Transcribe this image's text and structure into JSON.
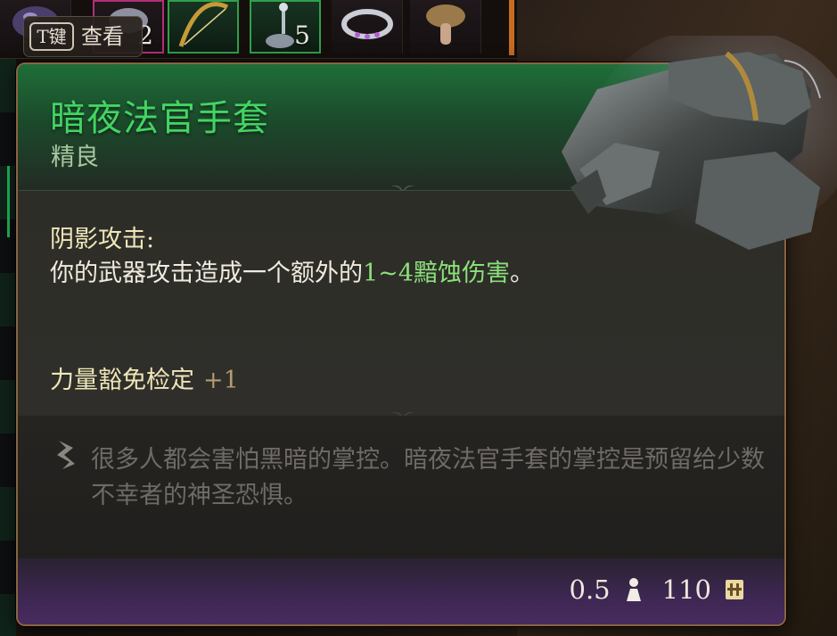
{
  "background": {
    "inventory_counts": {
      "slot_scroll": "2",
      "slot_potion": "5"
    },
    "key_hint": {
      "key": "T键",
      "label": "查看"
    }
  },
  "tooltip": {
    "name": "暗夜法官手套",
    "rarity": "精良",
    "ability": {
      "title": "阴影攻击:",
      "desc_prefix": "你的武器攻击造成一个额外的",
      "desc_highlight": "1~4黯蚀伤害",
      "desc_suffix": "。"
    },
    "bonus": {
      "label": "力量豁免检定",
      "value": "+1"
    },
    "lore": "很多人都会害怕黑暗的掌控。暗夜法官手套的掌控是预留给少数不幸者的神圣恐惧。",
    "footer": {
      "weight": "0.5",
      "value": "110"
    }
  },
  "colors": {
    "name": "#43d463",
    "rarity": "#a9c79f",
    "highlight": "#8be07a",
    "lore": "#6f6b66",
    "border": "#8a6440"
  },
  "icons": [
    "key-hint-icon",
    "lore-quill-icon",
    "weight-icon",
    "gold-icon",
    "gauntlets-icon"
  ]
}
